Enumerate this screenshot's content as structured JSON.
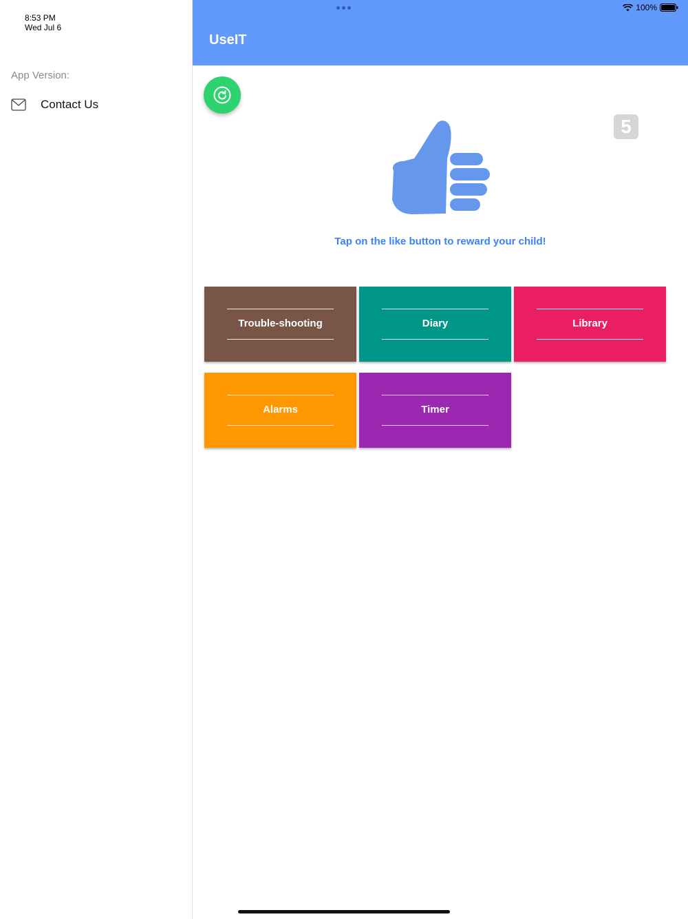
{
  "status_bar": {
    "time": "8:53 PM",
    "date": "Wed Jul 6",
    "battery": "100%",
    "wifi_icon": "wifi-icon",
    "battery_icon": "battery-icon"
  },
  "sidebar": {
    "app_version_label": "App Version:",
    "contact": {
      "label": "Contact Us",
      "icon": "mail-icon"
    }
  },
  "header": {
    "title": "UseIT",
    "background": "#6299fd"
  },
  "main": {
    "refresh_icon": "refresh-icon",
    "counter": "5",
    "like_icon": "thumbs-up-icon",
    "reward_text": "Tap on the like button to reward your child!"
  },
  "tiles": [
    {
      "label": "Trouble-shooting",
      "color": "#795548"
    },
    {
      "label": "Diary",
      "color": "#009688"
    },
    {
      "label": "Library",
      "color": "#e91e63"
    },
    {
      "label": "Alarms",
      "color": "#ff9800"
    },
    {
      "label": "Timer",
      "color": "#9c27b0"
    }
  ]
}
